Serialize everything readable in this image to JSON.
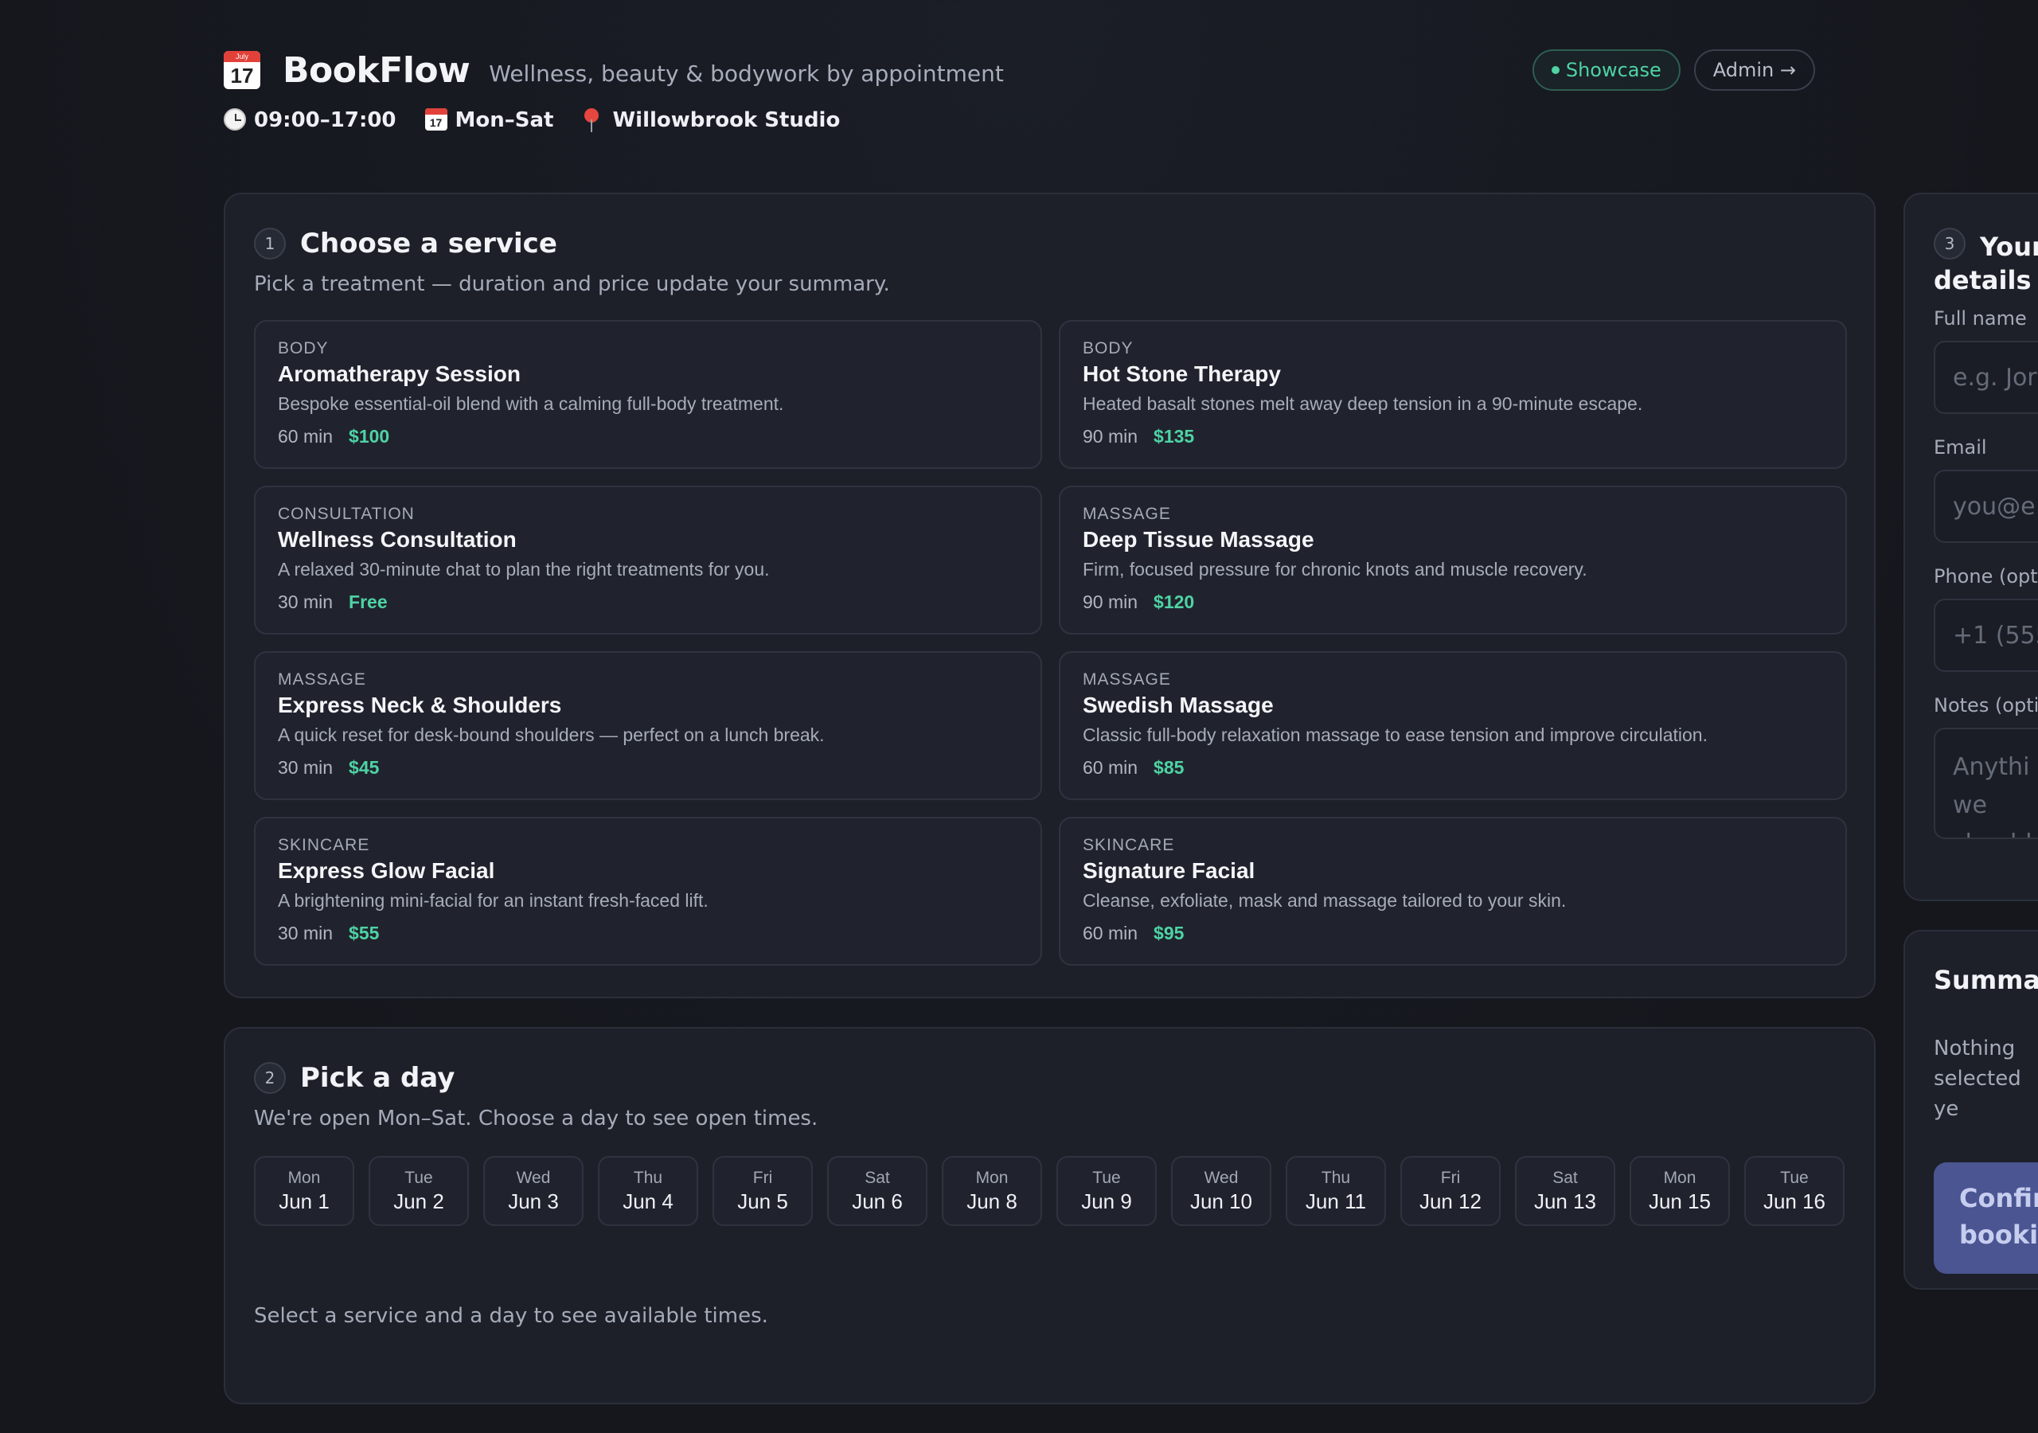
{
  "header": {
    "icon_month": "July",
    "icon_day": "17",
    "brand": "BookFlow",
    "tagline": "Wellness, beauty & bodywork by appointment",
    "showcase_label": "Showcase",
    "admin_label": "Admin →",
    "hours": "09:00–17:00",
    "days": "Mon–Sat",
    "location": "Willowbrook Studio"
  },
  "services_step": {
    "number": "1",
    "title": "Choose a service",
    "subtitle": "Pick a treatment — duration and price update your summary.",
    "items": [
      {
        "category": "BODY",
        "name": "Aromatherapy Session",
        "description": "Bespoke essential-oil blend with a calming full-body treatment.",
        "duration": "60 min",
        "price": "$100"
      },
      {
        "category": "BODY",
        "name": "Hot Stone Therapy",
        "description": "Heated basalt stones melt away deep tension in a 90-minute escape.",
        "duration": "90 min",
        "price": "$135"
      },
      {
        "category": "CONSULTATION",
        "name": "Wellness Consultation",
        "description": "A relaxed 30-minute chat to plan the right treatments for you.",
        "duration": "30 min",
        "price": "Free"
      },
      {
        "category": "MASSAGE",
        "name": "Deep Tissue Massage",
        "description": "Firm, focused pressure for chronic knots and muscle recovery.",
        "duration": "90 min",
        "price": "$120"
      },
      {
        "category": "MASSAGE",
        "name": "Express Neck & Shoulders",
        "description": "A quick reset for desk-bound shoulders — perfect on a lunch break.",
        "duration": "30 min",
        "price": "$45"
      },
      {
        "category": "MASSAGE",
        "name": "Swedish Massage",
        "description": "Classic full-body relaxation massage to ease tension and improve circulation.",
        "duration": "60 min",
        "price": "$85"
      },
      {
        "category": "SKINCARE",
        "name": "Express Glow Facial",
        "description": "A brightening mini-facial for an instant fresh-faced lift.",
        "duration": "30 min",
        "price": "$55"
      },
      {
        "category": "SKINCARE",
        "name": "Signature Facial",
        "description": "Cleanse, exfoliate, mask and massage tailored to your skin.",
        "duration": "60 min",
        "price": "$95"
      }
    ]
  },
  "day_step": {
    "number": "2",
    "title": "Pick a day",
    "subtitle": "We're open Mon–Sat. Choose a day to see open times.",
    "days": [
      {
        "dow": "Mon",
        "date": "Jun 1"
      },
      {
        "dow": "Tue",
        "date": "Jun 2"
      },
      {
        "dow": "Wed",
        "date": "Jun 3"
      },
      {
        "dow": "Thu",
        "date": "Jun 4"
      },
      {
        "dow": "Fri",
        "date": "Jun 5"
      },
      {
        "dow": "Sat",
        "date": "Jun 6"
      },
      {
        "dow": "Mon",
        "date": "Jun 8"
      },
      {
        "dow": "Tue",
        "date": "Jun 9"
      },
      {
        "dow": "Wed",
        "date": "Jun 10"
      },
      {
        "dow": "Thu",
        "date": "Jun 11"
      },
      {
        "dow": "Fri",
        "date": "Jun 12"
      },
      {
        "dow": "Sat",
        "date": "Jun 13"
      },
      {
        "dow": "Mon",
        "date": "Jun 15"
      },
      {
        "dow": "Tue",
        "date": "Jun 16"
      }
    ],
    "hint": "Select a service and a day to see available times."
  },
  "details_step": {
    "number": "3",
    "title_line1": "Your",
    "title_line2": "details",
    "full_name_label": "Full name",
    "full_name_placeholder": "e.g. Jor",
    "email_label": "Email",
    "email_placeholder": "you@e",
    "phone_label": "Phone (opti",
    "phone_placeholder": "+1 (555",
    "notes_label": "Notes (opti",
    "notes_placeholder": "Anythi we should"
  },
  "summary": {
    "title": "Summar",
    "empty_text": "Nothing selected ye",
    "confirm_label": "Confir bookin"
  },
  "colors": {
    "accent_green": "#4ed3a4",
    "confirm_button": "#4a5592",
    "card_bg": "#1d2029",
    "page_bg": "#16181f"
  }
}
